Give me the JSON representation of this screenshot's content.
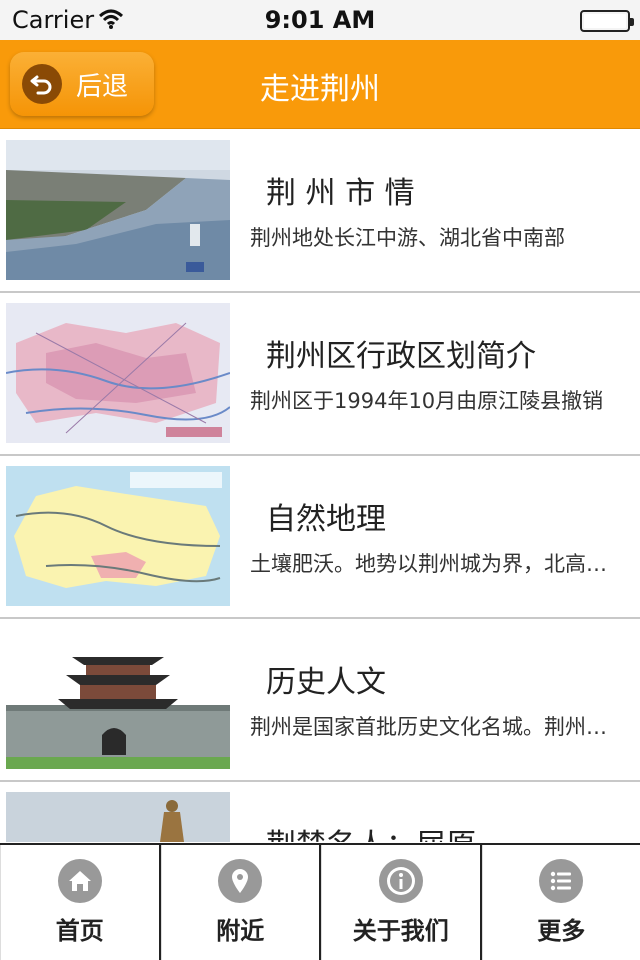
{
  "status": {
    "carrier": "Carrier",
    "time": "9:01 AM"
  },
  "nav": {
    "back_label": "后退",
    "title": "走进荆州"
  },
  "items": [
    {
      "title": "荆 州 市 情",
      "desc": "荆州地处长江中游、湖北省中南部"
    },
    {
      "title": "荆州区行政区划简介",
      "desc": "荆州区于1994年10月由原江陵县撤销"
    },
    {
      "title": "自然地理",
      "desc": "土壤肥沃。地势以荆州城为界，北高南低"
    },
    {
      "title": "历史人文",
      "desc": "荆州是国家首批历史文化名城。荆州古城"
    },
    {
      "title": "荆楚名人：屈原",
      "desc": ""
    }
  ],
  "tabs": [
    {
      "label": "首页",
      "icon": "home-icon"
    },
    {
      "label": "附近",
      "icon": "location-pin-icon"
    },
    {
      "label": "关于我们",
      "icon": "info-icon"
    },
    {
      "label": "更多",
      "icon": "list-icon"
    }
  ],
  "colors": {
    "accent": "#f99a0a",
    "tab_icon": "#999999"
  }
}
